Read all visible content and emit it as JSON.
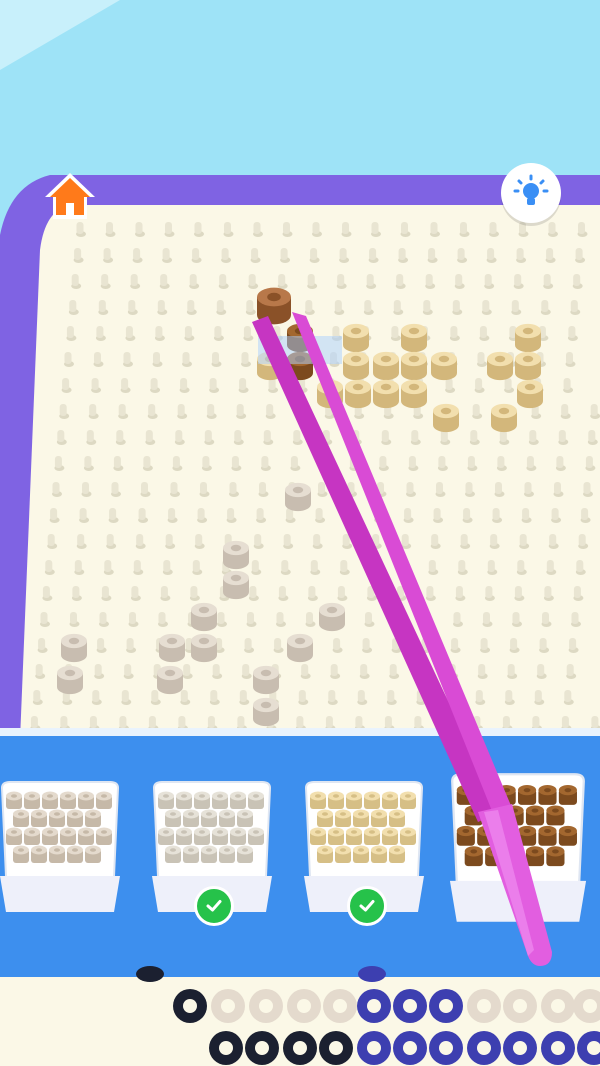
{
  "toolbar": {
    "home_icon": "home-icon",
    "hint_icon": "lightbulb-hint-icon"
  },
  "colors": {
    "sky": "#9ee3f7",
    "board_frame": "#7f63e3",
    "board_surface": "#fbf8e7",
    "tray_shelf": "#3d8fee",
    "tweezers": "#d63fd0",
    "bead_white": "#e4dacd",
    "bead_cream": "#f2dfae",
    "bead_tan": "#e0c48a",
    "bead_brown": "#a3672f",
    "check": "#26c24a"
  },
  "trays": [
    {
      "color_name": "bead-white",
      "completed": false
    },
    {
      "color_name": "bead-gray",
      "completed": true
    },
    {
      "color_name": "bead-tan",
      "completed": true
    },
    {
      "color_name": "bead-brown",
      "completed": false,
      "selected": true
    }
  ]
}
